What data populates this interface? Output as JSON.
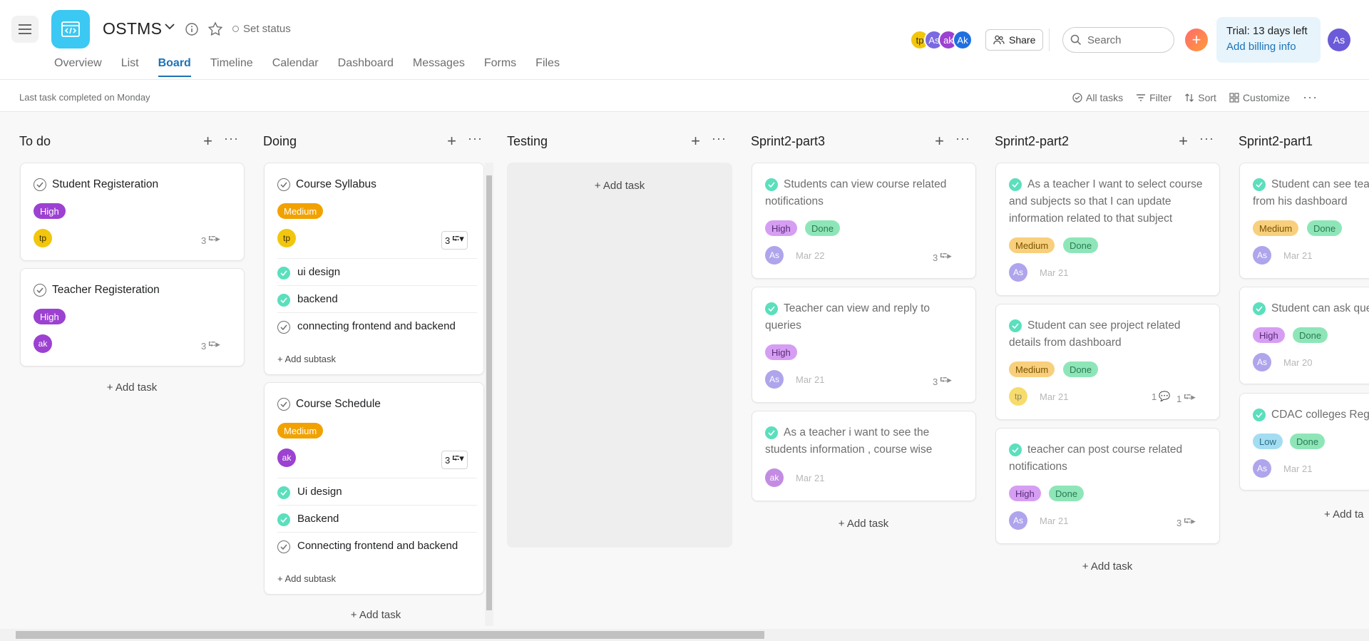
{
  "header": {
    "project_name": "OSTMS",
    "set_status": "Set status",
    "tabs": [
      "Overview",
      "List",
      "Board",
      "Timeline",
      "Calendar",
      "Dashboard",
      "Messages",
      "Forms",
      "Files"
    ],
    "active_tab": "Board",
    "members": [
      {
        "initials": "tp",
        "color": "#f1c60d"
      },
      {
        "initials": "As",
        "color": "#7a6ae0"
      },
      {
        "initials": "ak",
        "color": "#9c41d1"
      },
      {
        "initials": "Ak",
        "color": "#1f6fe0"
      }
    ],
    "share": "Share",
    "search_placeholder": "Search",
    "trial": "Trial: 13 days left",
    "billing": "Add billing info",
    "user_initials": "As"
  },
  "subbar": {
    "last_task": "Last task completed on Monday",
    "all_tasks": "All tasks",
    "filter": "Filter",
    "sort": "Sort",
    "customize": "Customize"
  },
  "columns": [
    {
      "title": "To do"
    },
    {
      "title": "Doing"
    },
    {
      "title": "Testing"
    },
    {
      "title": "Sprint2-part3"
    },
    {
      "title": "Sprint2-part2"
    },
    {
      "title": "Sprint2-part1"
    }
  ],
  "todo": {
    "cards": [
      {
        "title": "Student Registeration",
        "priority": "High",
        "assignee": "tp",
        "subtasks": "3"
      },
      {
        "title": "Teacher Registeration",
        "priority": "High",
        "assignee": "ak",
        "subtasks": "3"
      }
    ]
  },
  "doing": {
    "cards": [
      {
        "title": "Course Syllabus",
        "priority": "Medium",
        "assignee": "tp",
        "subtasks": "3",
        "subtask_items": [
          "ui design",
          "backend",
          "connecting frontend and backend"
        ]
      },
      {
        "title": "Course Schedule",
        "priority": "Medium",
        "assignee": "ak",
        "subtasks": "3",
        "subtask_items": [
          "Ui design",
          "Backend",
          "Connecting frontend and backend"
        ]
      }
    ]
  },
  "sprint3": {
    "cards": [
      {
        "title_line1": "Students can view course related",
        "title_line2": "notifications",
        "priority": "High",
        "status": "Done",
        "assignee": "As",
        "date": "Mar 22",
        "subtasks": "3"
      },
      {
        "title_line1": "Teacher can view and reply to",
        "title_line2": "queries",
        "priority": "High",
        "assignee": "As",
        "date": "Mar 21",
        "subtasks": "3"
      },
      {
        "title_line1": "As a teacher i want to see the",
        "title_line2": "students information , course wise",
        "assignee": "ak",
        "date": "Mar 21"
      }
    ]
  },
  "sprint2": {
    "cards": [
      {
        "title_line1": "As a teacher I want to select course",
        "title_line2": "and subjects so that I can update",
        "title_line3": "information related to that subject",
        "priority": "Medium",
        "status": "Done",
        "assignee": "As",
        "date": "Mar 21"
      },
      {
        "title_line1": "Student can see project related",
        "title_line2": "details from dashboard",
        "priority": "Medium",
        "status": "Done",
        "assignee": "tp",
        "date": "Mar 21",
        "comments": "1",
        "subtasks": "1"
      },
      {
        "title_line1": "teacher can post course related",
        "title_line2": "notifications",
        "priority": "High",
        "status": "Done",
        "assignee": "As",
        "date": "Mar 21",
        "subtasks": "3"
      }
    ]
  },
  "sprint1": {
    "cards": [
      {
        "title_line1": "Student can see tea",
        "title_line2": "from his dashboard",
        "priority": "Medium",
        "status": "Done",
        "assignee": "As",
        "date": "Mar 21"
      },
      {
        "title_line1": "Student can ask que",
        "priority": "High",
        "status": "Done",
        "assignee": "As",
        "date": "Mar 20"
      },
      {
        "title_line1": "CDAC colleges Regi",
        "priority": "Low",
        "status": "Done",
        "assignee": "As",
        "date": "Mar 21"
      }
    ]
  },
  "labels": {
    "add_task": "+ Add task",
    "add_subtask": "+ Add subtask",
    "add_task_partial": "+ Add ta"
  }
}
